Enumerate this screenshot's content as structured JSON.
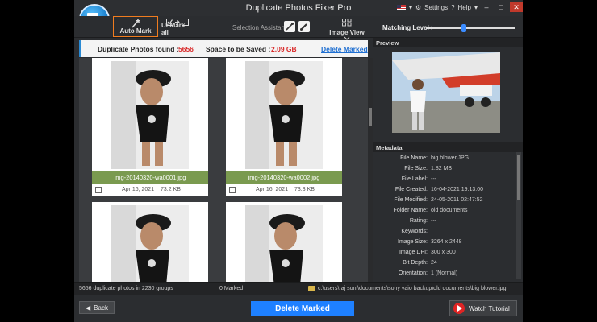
{
  "app": {
    "title": "Duplicate Photos Fixer Pro"
  },
  "titlebar": {
    "settings": "Settings",
    "help": "Help",
    "settings_glyph": "⚙",
    "help_glyph": "?",
    "min": "–",
    "max": "□",
    "close": "✕",
    "dropdown": "▾"
  },
  "toolbar": {
    "auto_mark": "Auto Mark",
    "unmark_all": "UnMark all",
    "selection_assistant": "Selection Assistant",
    "image_view": "Image View",
    "matching_level": "Matching Level :"
  },
  "info": {
    "found_label": "Duplicate Photos found :",
    "found_value": "5656",
    "space_label": "Space to be Saved :",
    "space_value": "2.09 GB",
    "delete_marked_link": "Delete Marked"
  },
  "photos": [
    {
      "name": "img-20140320-wa0001.jpg",
      "date": "Apr 16, 2021",
      "size": "73.2 KB"
    },
    {
      "name": "img-20140320-wa0002.jpg",
      "date": "Apr 16, 2021",
      "size": "73.3 KB"
    }
  ],
  "panel": {
    "preview": "Preview",
    "metadata": "Metadata"
  },
  "metadata": [
    {
      "key": "File Name:",
      "value": "big blower.JPG"
    },
    {
      "key": "File Size:",
      "value": "1.82 MB"
    },
    {
      "key": "File Label:",
      "value": "---"
    },
    {
      "key": "File Created:",
      "value": "16-04-2021 19:13:00"
    },
    {
      "key": "File Modified:",
      "value": "24-05-2011 02:47:52"
    },
    {
      "key": "Folder Name:",
      "value": "old documents"
    },
    {
      "key": "Rating:",
      "value": "---"
    },
    {
      "key": "Keywords:",
      "value": ""
    },
    {
      "key": "Image Size:",
      "value": "3264 x 2448"
    },
    {
      "key": "Image DPI:",
      "value": "300 x 300"
    },
    {
      "key": "Bit Depth:",
      "value": "24"
    },
    {
      "key": "Orientation:",
      "value": "1 (Normal)"
    }
  ],
  "status": {
    "groups": "5656 duplicate photos in 2230 groups",
    "marked": "0 Marked",
    "path": "c:\\users\\raj soni\\documents\\sony vaio backup\\old documents\\big blower.jpg"
  },
  "bottom": {
    "back": "Back",
    "delete_marked": "Delete Marked",
    "watch_tutorial": "Watch Tutorial"
  },
  "colors": {
    "accent": "#1e80ff",
    "highlight": "#f07c1f",
    "caption_bg": "#7a9a4f",
    "danger": "#d92b2b"
  }
}
